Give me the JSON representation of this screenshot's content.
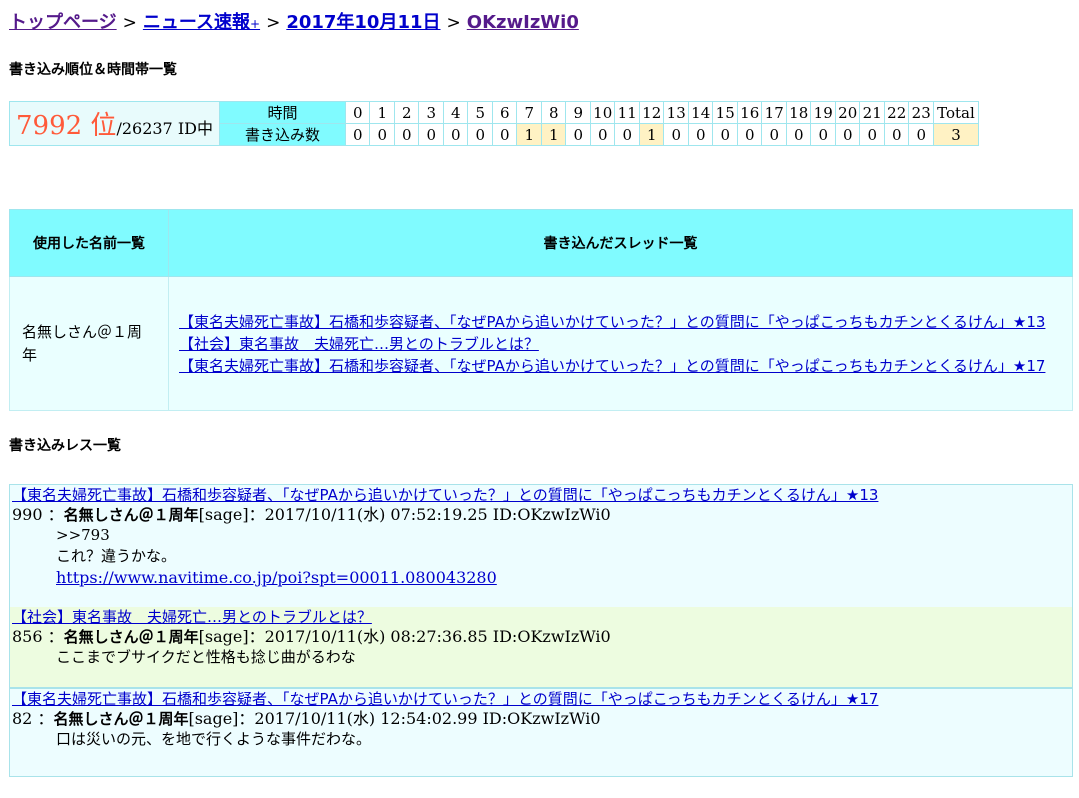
{
  "breadcrumb": {
    "top": "トップページ",
    "board": "ニュース速報",
    "board_plus": "+",
    "date": "2017年10月11日",
    "id": "OKzwIzWi0",
    "separator": ">"
  },
  "rank_section": {
    "title": "書き込み順位＆時間帯一覧",
    "rank": "7992 位",
    "total": "/26237 ID中",
    "hour_label": "時間",
    "count_label": "書き込み数",
    "hours": [
      "0",
      "1",
      "2",
      "3",
      "4",
      "5",
      "6",
      "7",
      "8",
      "9",
      "10",
      "11",
      "12",
      "13",
      "14",
      "15",
      "16",
      "17",
      "18",
      "19",
      "20",
      "21",
      "22",
      "23",
      "Total"
    ],
    "counts": [
      "0",
      "0",
      "0",
      "0",
      "0",
      "0",
      "0",
      "1",
      "1",
      "0",
      "0",
      "0",
      "1",
      "0",
      "0",
      "0",
      "0",
      "0",
      "0",
      "0",
      "0",
      "0",
      "0",
      "0",
      "3"
    ]
  },
  "names_table": {
    "name_header": "使用した名前一覧",
    "thread_header": "書き込んだスレッド一覧",
    "name": "名無しさん＠１周年",
    "threads": [
      "【東名夫婦死亡事故】石橋和歩容疑者、「なぜPAから追いかけていった？」との質問に「やっぱこっちもカチンとくるけん」★13",
      "【社会】東名事故　夫婦死亡…男とのトラブルとは？",
      "【東名夫婦死亡事故】石橋和歩容疑者、「なぜPAから追いかけていった？」との質問に「やっぱこっちもカチンとくるけん」★17"
    ]
  },
  "posts_section": {
    "title": "書き込みレス一覧",
    "posts": [
      {
        "thread": "【東名夫婦死亡事故】石橋和歩容疑者、「なぜPAから追いかけていった？」との質問に「やっぱこっちもカチンとくるけん」★13",
        "num": "990",
        "name": "名無しさん＠１周年",
        "rest": "[sage]：2017/10/11(水) 07:52:19.25 ID:OKzwIzWi0",
        "lines": [
          ">>793",
          "これ？違うかな。"
        ],
        "link": "https://www.navitime.co.jp/poi?spt=00011.080043280"
      },
      {
        "thread": "【社会】東名事故　夫婦死亡…男とのトラブルとは？",
        "num": "856",
        "name": "名無しさん＠１周年",
        "rest": "[sage]：2017/10/11(水) 08:27:36.85 ID:OKzwIzWi0",
        "lines": [
          "ここまでブサイクだと性格も捻じ曲がるわな"
        ]
      },
      {
        "thread": "【東名夫婦死亡事故】石橋和歩容疑者、「なぜPAから追いかけていった？」との質問に「やっぱこっちもカチンとくるけん」★17",
        "num": "82",
        "name": "名無しさん＠１周年",
        "rest": "[sage]：2017/10/11(水) 12:54:02.99 ID:OKzwIzWi0",
        "lines": [
          "口は災いの元、を地で行くような事件だわな。"
        ]
      }
    ]
  }
}
